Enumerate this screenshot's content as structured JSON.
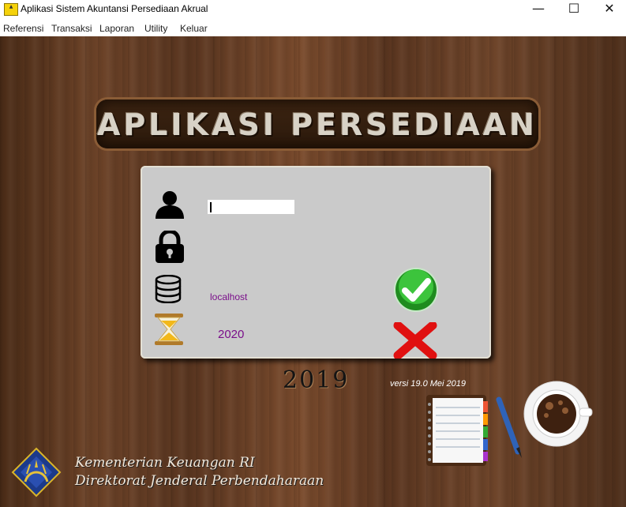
{
  "window": {
    "title": "Aplikasi Sistem Akuntansi Persediaan Akrual",
    "minimize_glyph": "—",
    "maximize_glyph": "☐",
    "close_glyph": "✕"
  },
  "menu": {
    "items": [
      {
        "label": "Referensi"
      },
      {
        "label": "Transaksi"
      },
      {
        "label": "Laporan"
      },
      {
        "label": "Utility"
      },
      {
        "label": "Keluar"
      }
    ]
  },
  "banner": {
    "title": "APLIKASI PERSEDIAAN"
  },
  "login": {
    "username_value": "",
    "server": "localhost",
    "year": "2020",
    "icons": {
      "user": "user-icon",
      "password": "lock-icon",
      "server": "database-icon",
      "year": "hourglass-icon",
      "ok": "checkmark-icon",
      "cancel": "cross-icon"
    }
  },
  "decor": {
    "big_year": "2019",
    "version": "versi 19.0  Mei 2019"
  },
  "footer": {
    "line1": "Kementerian Keuangan RI",
    "line2": "Direktorat Jenderal Perbendaharaan"
  },
  "colors": {
    "accent_text": "#7a0f8a",
    "ok_green": "#2bb52b",
    "cancel_red": "#e01010",
    "panel": "#cacaca"
  }
}
